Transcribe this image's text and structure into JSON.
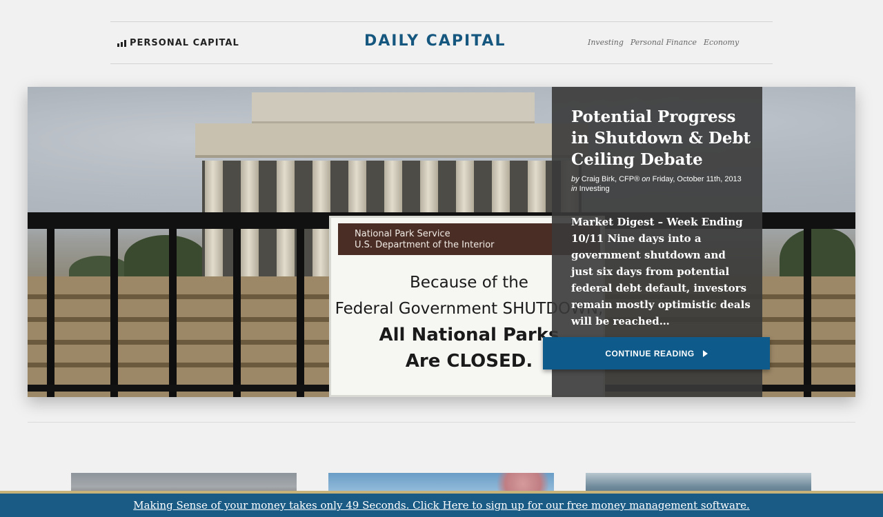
{
  "header": {
    "brand": "PERSONAL CAPITAL",
    "site_title": "DAILY CAPITAL",
    "nav": [
      "Investing",
      "Personal Finance",
      "Economy"
    ]
  },
  "hero": {
    "image_sign": {
      "band_line1": "National Park Service",
      "band_line2": "U.S. Department of the Interior",
      "line1": "Because of the",
      "line2": "Federal Government SHUTDOWN,",
      "line3": "All National Parks",
      "line4": "Are CLOSED."
    },
    "title": "Potential Progress in Shutdown & Debt Ceiling Debate",
    "byline": {
      "by": "by",
      "author": "Craig Birk, CFP®",
      "on": "on",
      "date": "Friday, October 11th, 2013",
      "in": "in",
      "category": "Investing"
    },
    "excerpt": "Market Digest – Week Ending 10/11 Nine days into a government shutdown and just six days from potential federal debt default, investors remain mostly optimistic deals will be reached…",
    "cta_label": "CONTINUE READING"
  },
  "bottom_bar": {
    "text": "Making Sense of your money takes only 49 Seconds. Click Here to sign up for our free money management software."
  },
  "colors": {
    "accent": "#0e5a8a",
    "title_blue": "#15577f",
    "bar_border": "#c7b27a"
  }
}
